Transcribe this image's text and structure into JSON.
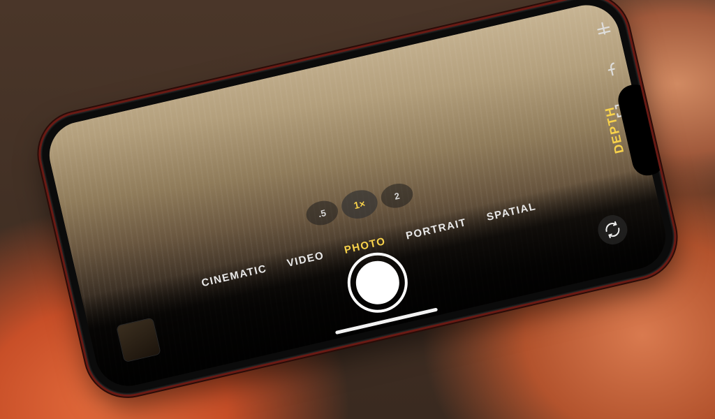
{
  "depth_label": "DEPTH",
  "zoom": {
    "options": [
      {
        "label": ".5",
        "active": false
      },
      {
        "label": "1×",
        "active": true
      },
      {
        "label": "2",
        "active": false
      }
    ]
  },
  "modes": [
    {
      "label": "CINEMATIC",
      "active": false
    },
    {
      "label": "VIDEO",
      "active": false
    },
    {
      "label": "PHOTO",
      "active": true
    },
    {
      "label": "PORTRAIT",
      "active": false
    },
    {
      "label": "SPATIAL",
      "active": false
    }
  ],
  "icons": {
    "exposure": "exposure-icon",
    "aperture": "f-stop-icon",
    "capture_ui": "capture-frame-icon",
    "flip": "flip-camera-icon"
  },
  "colors": {
    "accent_yellow": "#f8d24b",
    "phone_frame_red": "#6a1a14"
  }
}
